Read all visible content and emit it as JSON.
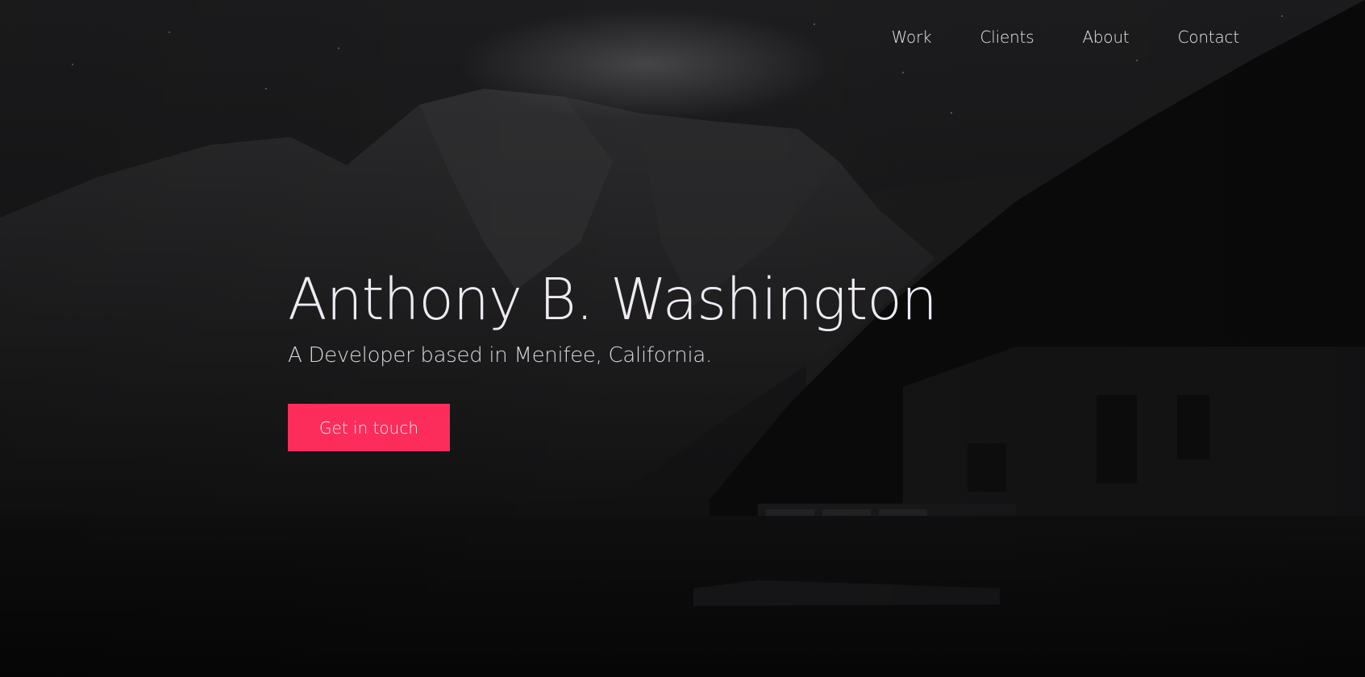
{
  "nav": {
    "items": [
      {
        "label": "Work"
      },
      {
        "label": "Clients"
      },
      {
        "label": "About"
      },
      {
        "label": "Contact"
      }
    ]
  },
  "hero": {
    "title": "Anthony B. Washington",
    "subtitle": "A Developer based in Menifee, California.",
    "cta_label": "Get in touch"
  },
  "colors": {
    "accent": "#fd2d5b",
    "background": "#0b0b0c",
    "text": "#efeaf2"
  },
  "background_image": "dark-mountain-lake-cabin-night"
}
